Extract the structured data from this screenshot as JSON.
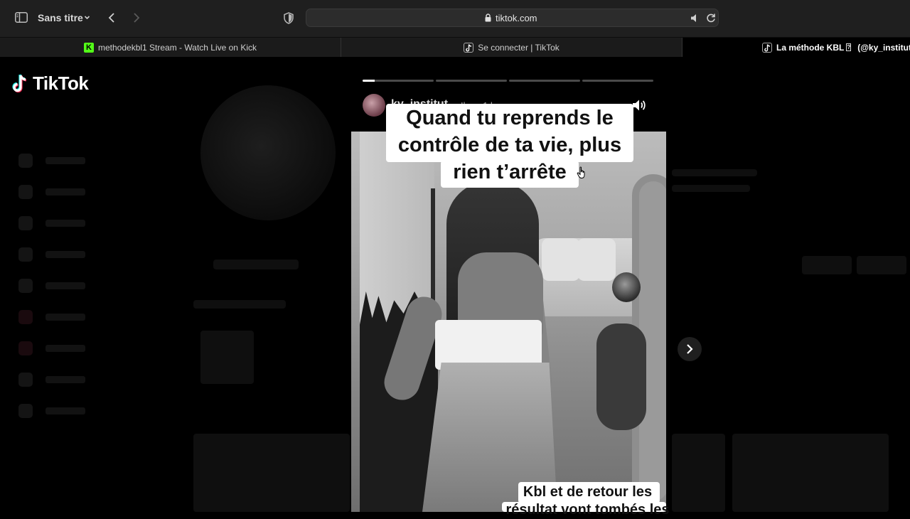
{
  "browser": {
    "window_title": "Sans titre",
    "url": "tiktok.com",
    "tabs": [
      {
        "label": "methodekbl1 Stream - Watch Live on Kick",
        "favicon": "kick-icon"
      },
      {
        "label": "Se connecter | TikTok",
        "favicon": "tiktok-icon"
      },
      {
        "label_prefix": "La méthode KBL",
        "label_suffix": "(@ky_institut",
        "favicon": "tiktok-icon",
        "active": true
      }
    ]
  },
  "site": {
    "logo_text": "TikTok"
  },
  "story": {
    "username": "ky_institut",
    "time_ago": "Il y a 1 h",
    "progress_segments": [
      0.17,
      0,
      0,
      0
    ],
    "caption_top": "Quand tu reprends le\ncontrôle de ta vie, plus\nrien t’arrête",
    "caption_bottom": "Kbl et de retour les\nrésultat vont tombés les"
  },
  "colors": {
    "background": "#000000",
    "chrome": "#1f1f1f",
    "kick_green": "#53fc18",
    "accent_red": "#e0113a"
  }
}
